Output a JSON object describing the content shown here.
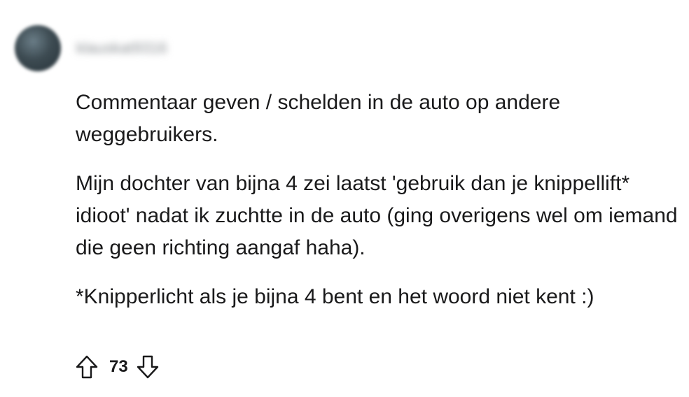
{
  "comment": {
    "author": "klauskat9316",
    "paragraphs": [
      "Commentaar geven / schelden in de auto op andere weggebruikers.",
      "Mijn dochter van bijna 4 zei laatst 'gebruik dan je knippellift* idioot' nadat ik zuchtte in de auto (ging overigens wel om iemand die geen richting aangaf haha).",
      "*Knipperlicht als je bijna 4 bent en het woord niet kent :)"
    ],
    "votes": "73",
    "icons": {
      "upvote": "arrow-up-outline-icon",
      "downvote": "arrow-down-outline-icon"
    }
  }
}
